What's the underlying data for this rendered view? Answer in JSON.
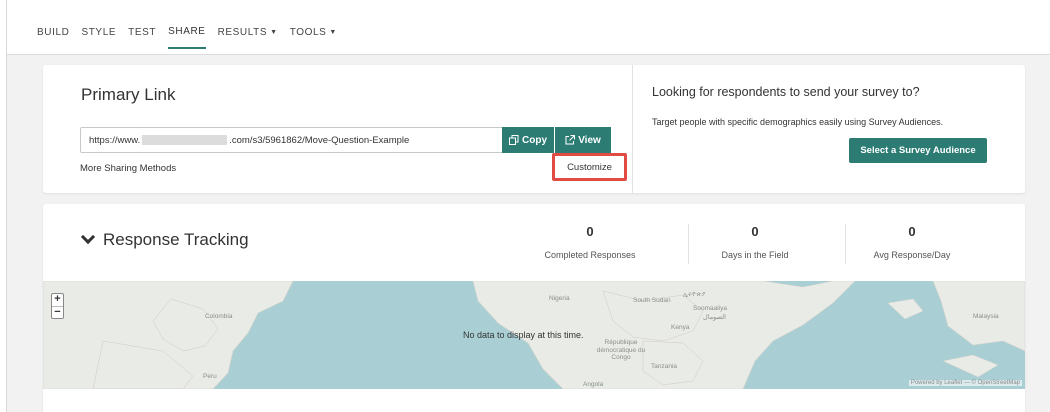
{
  "nav": {
    "items": [
      {
        "label": "BUILD",
        "dropdown": false,
        "active": false
      },
      {
        "label": "STYLE",
        "dropdown": false,
        "active": false
      },
      {
        "label": "TEST",
        "dropdown": false,
        "active": false
      },
      {
        "label": "SHARE",
        "dropdown": false,
        "active": true
      },
      {
        "label": "RESULTS",
        "dropdown": true,
        "active": false
      },
      {
        "label": "TOOLS",
        "dropdown": true,
        "active": false
      }
    ]
  },
  "primary_link": {
    "title": "Primary Link",
    "url_prefix": "https://www.",
    "url_suffix": ".com/s3/5961862/Move-Question-Example",
    "copy_label": "Copy",
    "view_label": "View",
    "more_methods": "More Sharing Methods",
    "customize": "Customize"
  },
  "audience": {
    "title": "Looking for respondents to send your survey to?",
    "subtitle": "Target people with specific demographics easily using Survey Audiences.",
    "button": "Select a Survey Audience"
  },
  "tracking": {
    "title": "Response Tracking",
    "stats": [
      {
        "value": "0",
        "label": "Completed Responses"
      },
      {
        "value": "0",
        "label": "Days in the Field"
      },
      {
        "value": "0",
        "label": "Avg Response/Day"
      }
    ]
  },
  "map": {
    "message": "No data to display at this time.",
    "zoom_in": "+",
    "zoom_out": "−",
    "places": [
      "Colombia",
      "Peru",
      "Nigeria",
      "South Sudan",
      "Kenya",
      "Soomaaliya",
      "Tanzania",
      "Angola",
      "Malaysia",
      "République démocratique du Congo",
      "ኢትዮጵያ",
      "الصومال"
    ],
    "attribution": "Powered by Leaflet — © OpenStreetMap"
  },
  "colors": {
    "accent": "#2c7c74",
    "highlight": "#e04b44",
    "water": "#a9cfd4"
  }
}
